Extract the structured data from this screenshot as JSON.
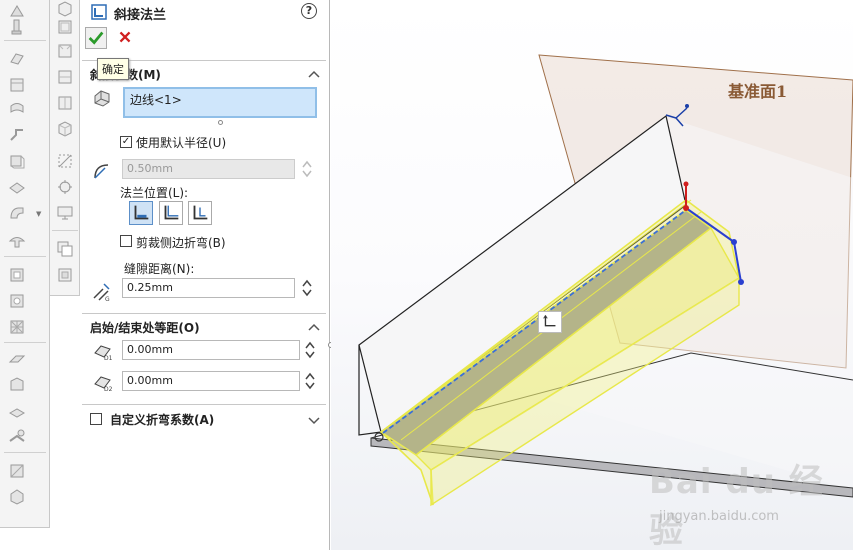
{
  "panel": {
    "title": "斜接法兰",
    "help": "?",
    "ok_tooltip": "确定",
    "section_params_title": "斜接参数(M)",
    "edge_list_value": "边线<1>",
    "use_default_radius_label": "使用默认半径(U)",
    "use_default_radius_checked": true,
    "radius_value": "0.50mm",
    "flange_position_label": "法兰位置(L):",
    "trim_side_bends_label": "剪裁侧边折弯(B)",
    "trim_side_bends_checked": false,
    "gap_distance_label": "缝隙距离(N):",
    "gap_value": "0.25mm",
    "section_offset_title": "启始/结束处等距(O)",
    "start_offset_value": "0.00mm",
    "end_offset_value": "0.00mm",
    "custom_bend_label": "自定义折弯系数(A)",
    "custom_bend_checked": false
  },
  "viewport": {
    "plane_label": "基准面1",
    "watermark_brand": "Bai du 经验",
    "watermark_url": "jingyan.baidu.com"
  },
  "colors": {
    "selection_yellow": "#f3f365",
    "edge_blue": "#3a6fd8",
    "plane_brown": "#a0704a",
    "ok_green": "#2a9a2a",
    "cancel_red": "#d02020"
  }
}
